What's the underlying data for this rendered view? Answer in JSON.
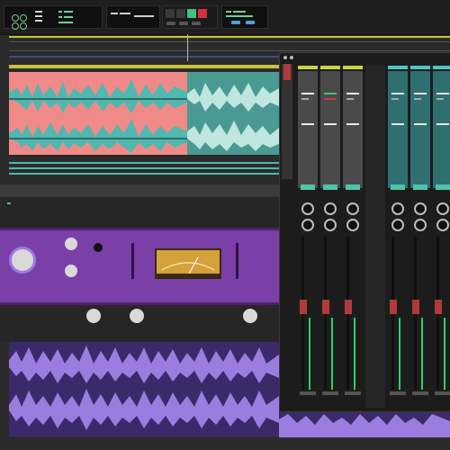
{
  "app": {
    "transport": {
      "icons": [
        "grid-icon",
        "menu-icon",
        "display-icon"
      ],
      "colors": {
        "green": "#42c27a",
        "red": "#d8303a",
        "blue": "#4aa3d8"
      }
    },
    "tracks": [
      {
        "name": "",
        "color": "#f08a88",
        "wave_color": "#4fb8b0"
      },
      {
        "name": "",
        "color": "#4fb8b0",
        "wave_color": "#4fb8b0"
      },
      {
        "name": "",
        "color": "#9b7de0",
        "wave_color": "#9b7de0"
      }
    ],
    "plugin": {
      "color": "#7b3fa8",
      "meter_color": "#d4a13a"
    },
    "mixer": {
      "channel_colors": [
        "#cbd343",
        "#cbd343",
        "#cbd343",
        "#4fc4c4",
        "#4fc4c4",
        "#4fc4c4"
      ],
      "channel_count": 6
    }
  }
}
